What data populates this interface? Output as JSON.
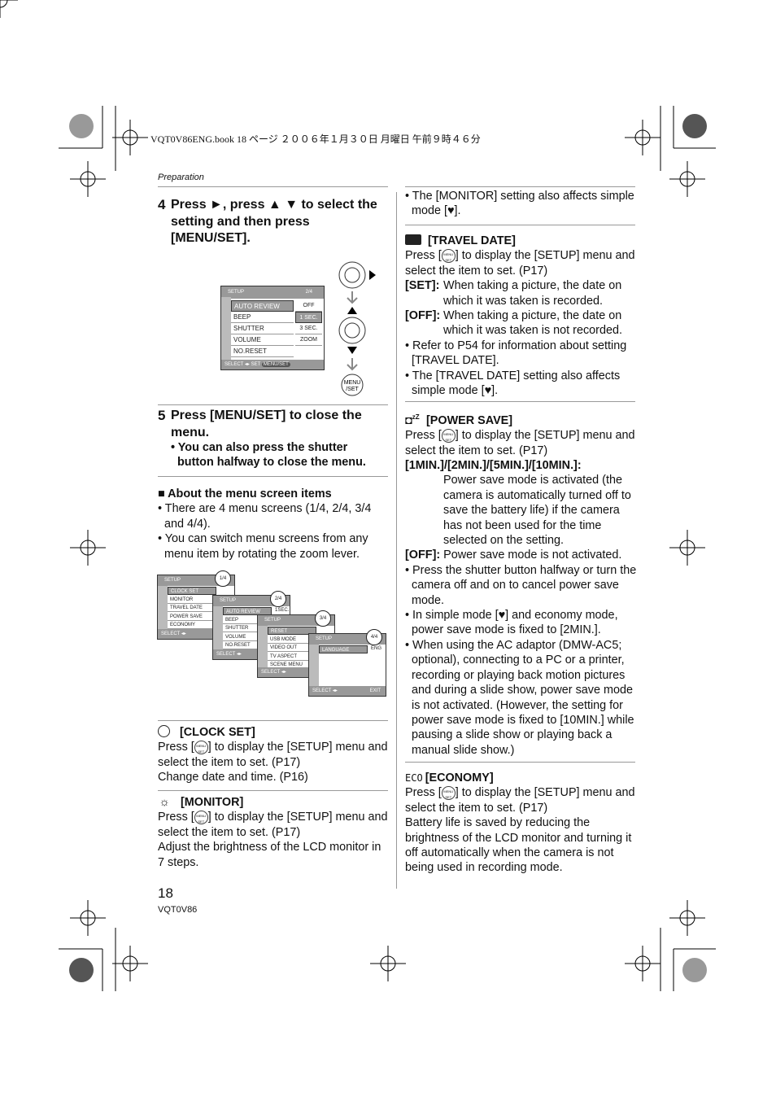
{
  "header": {
    "print_line": "VQT0V86ENG.book  18 ページ  ２００６年１月３０日  月曜日  午前９時４６分"
  },
  "section": "Preparation",
  "step4": {
    "num": "4",
    "text": "Press ►, press ▲ ▼ to select the setting and then press [MENU/SET]."
  },
  "screen": {
    "title": "SETUP",
    "page": "2/4",
    "items": [
      "AUTO REVIEW",
      "BEEP",
      "SHUTTER",
      "VOLUME",
      "NO.RESET"
    ],
    "options": [
      "OFF",
      "1 SEC.",
      "3 SEC.",
      "ZOOM"
    ],
    "footer": "SELECT ◂▸  SET",
    "menu_label": "MENU/SET"
  },
  "step5": {
    "num": "5",
    "text": "Press [MENU/SET] to close the menu.",
    "bullet": "You can also press the shutter button halfway to close the menu."
  },
  "about": {
    "heading": "■ About the menu screen items",
    "bullets": [
      "There are 4 menu screens (1/4, 2/4, 3/4 and 4/4).",
      "You can switch menu screens from any menu item by rotating the zoom lever."
    ]
  },
  "screens": [
    {
      "title": "SETUP",
      "page": "1/4",
      "items": [
        "CLOCK SET",
        "MONITOR",
        "TRAVEL DATE",
        "POWER SAVE",
        "ECONOMY"
      ],
      "footer": "SELECT ◂▸",
      "value": ""
    },
    {
      "title": "SETUP",
      "page": "2/4",
      "items": [
        "AUTO REVIEW",
        "BEEP",
        "SHUTTER",
        "VOLUME",
        "NO.RESET"
      ],
      "footer": "SELECT ◂▸",
      "value": "1SEC."
    },
    {
      "title": "SETUP",
      "page": "3/4",
      "items": [
        "RESET",
        "USB MODE",
        "VIDEO OUT",
        "TV ASPECT",
        "SCENE MENU"
      ],
      "footer": "SELECT ◂▸",
      "value": ""
    },
    {
      "title": "SETUP",
      "page": "4/4",
      "items": [
        "LANGUAGE"
      ],
      "footer": "SELECT ◂▸",
      "value": "ENG",
      "exit": "EXIT"
    }
  ],
  "press_pre": "Press [",
  "press_post": "] to display the [SETUP] menu and select the item to set. (P17)",
  "clock": {
    "title": "[CLOCK SET]",
    "icon": "clock-icon",
    "extra": "Change date and time. (P16)"
  },
  "monitor": {
    "title": "[MONITOR]",
    "icon": "sun-icon",
    "extra": "Adjust the brightness of the LCD monitor in 7 steps."
  },
  "monitor_note": {
    "pre": "The [MONITOR] setting also affects simple mode [",
    "post": "]."
  },
  "travel": {
    "title": "[TRAVEL DATE]",
    "icon": "suitcase-icon",
    "set_label": "[SET]:",
    "set_text": "When taking a picture, the date on which it was taken is recorded.",
    "off_label": "[OFF]:",
    "off_text": "When taking a picture, the date on which it was taken is not recorded.",
    "bullets": [
      "Refer to P54 for information about setting [TRAVEL DATE]."
    ],
    "note_pre": "The [TRAVEL DATE] setting also affects simple mode [",
    "note_post": "]."
  },
  "power": {
    "title": "[POWER SAVE]",
    "icon": "camera-sleep-icon",
    "opts_label": "[1MIN.]/[2MIN.]/[5MIN.]/[10MIN.]:",
    "opts_text": "Power save mode is activated (the camera is automatically turned off to save the battery life) if the camera has not been used for the time selected on the setting.",
    "off_label": "[OFF]:",
    "off_text": "Power save mode is not activated.",
    "b1": "Press the shutter button halfway or turn the camera off and on to cancel power save mode.",
    "b2_pre": "In simple mode [",
    "b2_post": "] and economy mode, power save mode is fixed to [2MIN.].",
    "b3": "When using the AC adaptor (DMW-AC5; optional), connecting to a PC or a printer, recording or playing back motion pictures and during a slide show, power save mode is not activated. (However, the setting for power save mode is fixed to [10MIN.] while pausing a slide show or playing back a manual slide show.)"
  },
  "economy": {
    "title": "[ECONOMY]",
    "icon_text": "ECO",
    "extra": "Battery life is saved by reducing the brightness of the LCD monitor and turning it off automatically when the camera is not being used in recording mode."
  },
  "footer": {
    "page_num": "18",
    "code": "VQT0V86"
  }
}
